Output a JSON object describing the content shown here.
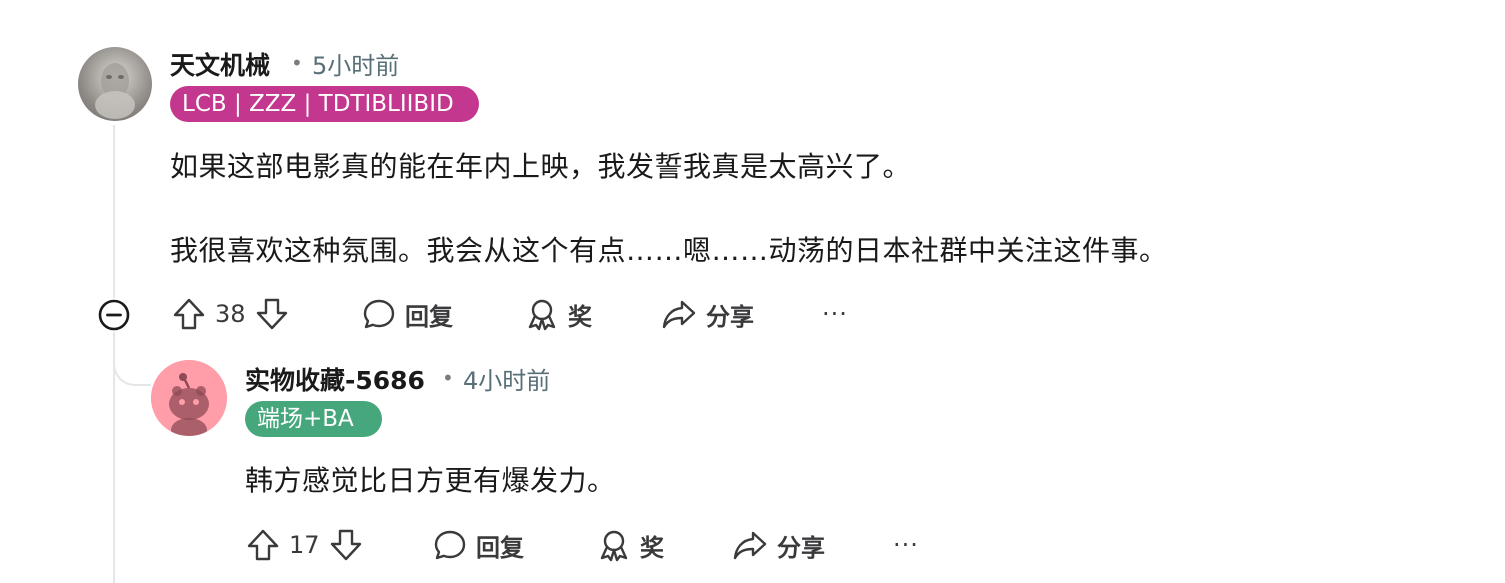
{
  "comments": [
    {
      "username": "天文机械",
      "time": "5小时前",
      "flair": "LCB | ZZZ | TDTIBLIIBID",
      "flair_color": "#c3378e",
      "paragraphs": [
        "如果这部电影真的能在年内上映，我发誓我真是太高兴了。",
        "我很喜欢这种氛围。我会从这个有点……嗯……动荡的日本社群中关注这件事。"
      ],
      "votes": "38",
      "reply_label": "回复",
      "award_label": "奖",
      "share_label": "分享",
      "more_label": "···"
    },
    {
      "username": "实物收藏-5686",
      "time": "4小时前",
      "flair": "端场+BA",
      "flair_color": "#46a77c",
      "paragraphs": [
        "韩方感觉比日方更有爆发力。"
      ],
      "votes": "17",
      "reply_label": "回复",
      "award_label": "奖",
      "share_label": "分享",
      "more_label": "···"
    }
  ],
  "icons": {
    "upvote": "arrow-up-icon",
    "downvote": "arrow-down-icon",
    "reply": "speech-bubble-icon",
    "award": "award-icon",
    "share": "share-arrow-icon",
    "collapse": "minus-circle-icon",
    "more": "ellipsis-icon"
  }
}
